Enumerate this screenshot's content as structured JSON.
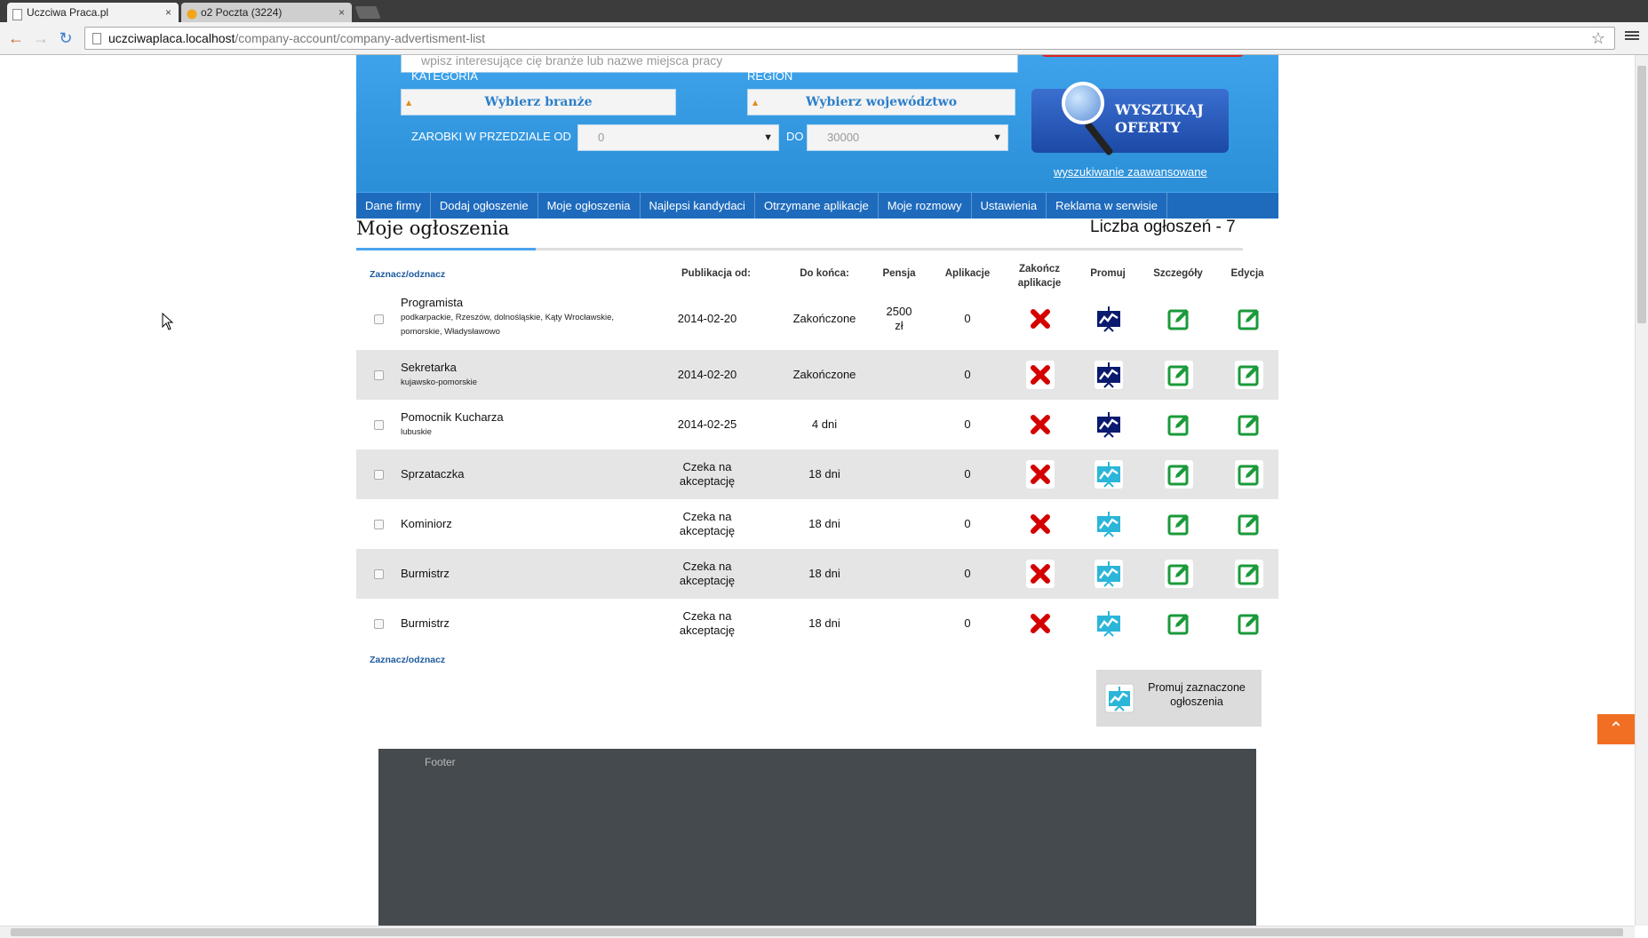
{
  "browser": {
    "tabs": [
      {
        "label": "Uczciwa Praca.pl",
        "active": true
      },
      {
        "label": "o2 Poczta (3224)",
        "active": false
      }
    ],
    "url_host": "uczciwaplaca.localhost",
    "url_path": "/company-account/company-advertisment-list",
    "tab_close": "×"
  },
  "search": {
    "keyword_placeholder": "wpisz interesujące cię branże lub nazwe miejsca pracy",
    "category_label": "KATEGORIA",
    "category_value": "Wybierz branże",
    "region_label": "REGION",
    "region_value": "Wybierz województwo",
    "salary_label": "ZAROBKI W PRZEDZIALE OD",
    "salary_from": "0",
    "salary_to_label": "DO",
    "salary_to": "30000",
    "button_label_1": "WYSZUKAJ",
    "button_label_2": "OFERTY",
    "advanced_link": "wyszukiwanie zaawansowane"
  },
  "nav": [
    "Dane firmy",
    "Dodaj ogłoszenie",
    "Moje ogłoszenia",
    "Najlepsi kandydaci",
    "Otrzymane aplikacje",
    "Moje rozmowy",
    "Ustawienia",
    "Reklama w serwisie"
  ],
  "page": {
    "title": "Moje ogłoszenia",
    "count": "Liczba ogłoszeń - 7",
    "select_all": "Zaznacz/odznacz",
    "select_all_bottom": "Zaznacz/odznacz"
  },
  "table": {
    "headers": {
      "published": "Publikacja od:",
      "remaining": "Do końca:",
      "salary": "Pensja",
      "applications": "Aplikacje",
      "end_1": "Zakończ",
      "end_2": "aplikacje",
      "promote": "Promuj",
      "details": "Szczegóły",
      "edit": "Edycja"
    },
    "rows": [
      {
        "title": "Programista",
        "location_1": "podkarpackie, Rzeszów, dolnośląskie, Kąty Wrocławskie,",
        "location_2": "pomorskie, Władysławowo",
        "published_1": "2014-02-20",
        "published_2": "",
        "remaining": "Zakończone",
        "salary_1": "2500",
        "salary_2": "zł",
        "applications": "0",
        "promote_state": "dark"
      },
      {
        "title": "Sekretarka",
        "location_1": "kujawsko-pomorskie",
        "location_2": "",
        "published_1": "2014-02-20",
        "published_2": "",
        "remaining": "Zakończone",
        "salary_1": "",
        "salary_2": "",
        "applications": "0",
        "promote_state": "dark"
      },
      {
        "title": "Pomocnik Kucharza",
        "location_1": "lubuskie",
        "location_2": "",
        "published_1": "2014-02-25",
        "published_2": "",
        "remaining": "4 dni",
        "salary_1": "",
        "salary_2": "",
        "applications": "0",
        "promote_state": "dark"
      },
      {
        "title": "Sprzataczka",
        "location_1": "",
        "location_2": "",
        "published_1": "Czeka na",
        "published_2": "akceptację",
        "remaining": "18 dni",
        "salary_1": "",
        "salary_2": "",
        "applications": "0",
        "promote_state": "light"
      },
      {
        "title": "Kominiorz",
        "location_1": "",
        "location_2": "",
        "published_1": "Czeka na",
        "published_2": "akceptację",
        "remaining": "18 dni",
        "salary_1": "",
        "salary_2": "",
        "applications": "0",
        "promote_state": "light"
      },
      {
        "title": "Burmistrz",
        "location_1": "",
        "location_2": "",
        "published_1": "Czeka na",
        "published_2": "akceptację",
        "remaining": "18 dni",
        "salary_1": "",
        "salary_2": "",
        "applications": "0",
        "promote_state": "light"
      },
      {
        "title": "Burmistrz",
        "location_1": "",
        "location_2": "",
        "published_1": "Czeka na",
        "published_2": "akceptację",
        "remaining": "18 dni",
        "salary_1": "",
        "salary_2": "",
        "applications": "0",
        "promote_state": "light"
      }
    ]
  },
  "promote_selected": {
    "line_1": "Promuj zaznaczone",
    "line_2": "ogłoszenia"
  },
  "footer": "Footer",
  "colors": {
    "header_blue": "#3ea3ea",
    "nav_blue": "#1e6bbd",
    "to_top": "#f16f23",
    "end_red": "#d40000",
    "edit_green": "#1a9a3a"
  }
}
